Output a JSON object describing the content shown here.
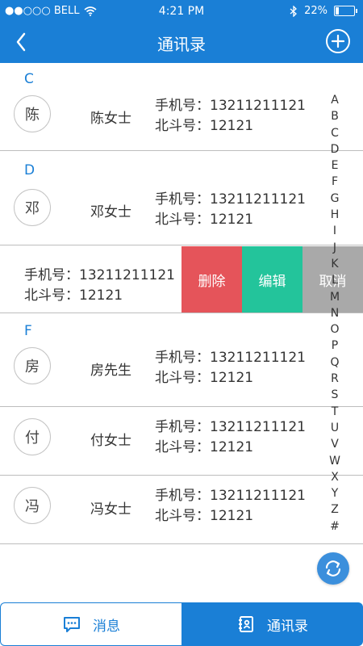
{
  "status_bar": {
    "carrier": "●●○○○ BELL",
    "time": "4:21 PM",
    "battery_text": "22%",
    "battery_level": 0.22
  },
  "nav": {
    "title": "通讯录",
    "back_icon": "chevron-left-icon",
    "add_icon": "plus-circle-icon"
  },
  "sections": [
    {
      "letter": "C",
      "contacts": [
        {
          "avatar": "陈",
          "name": "陈女士",
          "phone_label": "手机号：",
          "phone": "13211211121",
          "beidou_label": "北斗号：",
          "beidou": "12121"
        }
      ]
    },
    {
      "letter": "D",
      "contacts": [
        {
          "avatar": "邓",
          "name": "邓女士",
          "phone_label": "手机号：",
          "phone": "13211211121",
          "beidou_label": "北斗号：",
          "beidou": "12121"
        }
      ]
    },
    {
      "letter": "F",
      "contacts": [
        {
          "avatar": "房",
          "name": "房先生",
          "phone_label": "手机号：",
          "phone": "13211211121",
          "beidou_label": "北斗号：",
          "beidou": "12121"
        },
        {
          "avatar": "付",
          "name": "付女士",
          "phone_label": "手机号：",
          "phone": "13211211121",
          "beidou_label": "北斗号：",
          "beidou": "12121"
        },
        {
          "avatar": "冯",
          "name": "冯女士",
          "phone_label": "手机号：",
          "phone": "13211211121",
          "beidou_label": "北斗号：",
          "beidou": "12121"
        }
      ]
    }
  ],
  "swiped_row": {
    "phone_label": "手机号：",
    "phone": "13211211121",
    "beidou_label": "北斗号：",
    "beidou": "12121",
    "actions": {
      "delete": "删除",
      "edit": "编辑",
      "cancel": "取消"
    }
  },
  "index_letters": [
    "A",
    "B",
    "C",
    "D",
    "E",
    "F",
    "G",
    "H",
    "I",
    "J",
    "K",
    "L",
    "M",
    "N",
    "O",
    "P",
    "Q",
    "R",
    "S",
    "T",
    "U",
    "V",
    "W",
    "X",
    "Y",
    "Z",
    "#"
  ],
  "tabs": {
    "messages": "消息",
    "contacts": "通讯录"
  },
  "colors": {
    "primary": "#1a7fd6",
    "delete": "#e5545a",
    "edit": "#23c49b",
    "cancel": "#a9a9a9"
  }
}
